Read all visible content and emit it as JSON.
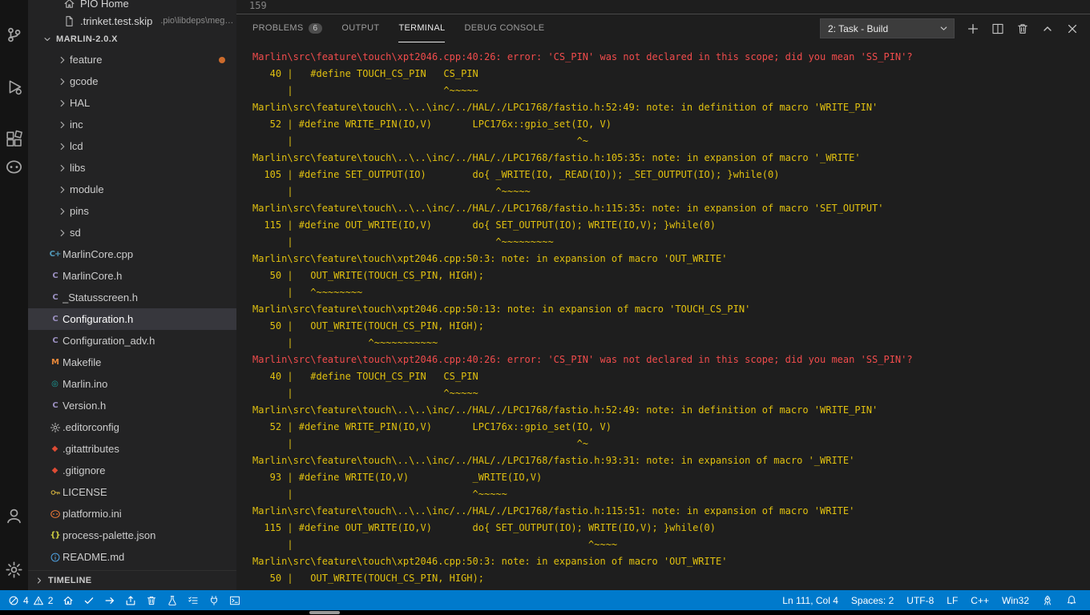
{
  "colors": {
    "accent": "#007acc",
    "terminal_error_red": "#f14c4c",
    "terminal_note_yellow": "#e0c010",
    "selected_row": "#37373d"
  },
  "window": {
    "editor_visible_line": "159"
  },
  "activity_bar": {
    "top": [
      {
        "icon": "source-control",
        "name": "activitybar-source-control"
      },
      {
        "icon": "run-debug",
        "name": "activitybar-run-and-debug"
      },
      {
        "icon": "extensions",
        "name": "activitybar-extensions"
      },
      {
        "icon": "platformio",
        "name": "activitybar-platformio"
      }
    ],
    "bottom": [
      {
        "icon": "account",
        "name": "activitybar-account"
      },
      {
        "icon": "settings",
        "name": "activitybar-manage"
      }
    ]
  },
  "sidebar": {
    "open_editors": [
      {
        "icon": "home",
        "label": "PIO Home",
        "name": "open-editor-pio-home"
      },
      {
        "icon": "file",
        "label": ".trinket.test.skip",
        "description": ".pio\\libdeps\\mega...",
        "name": "open-editor-trinket-test-skip"
      }
    ],
    "section_label": "MARLIN-2.0.X",
    "marlin_chevron": "chevron-down",
    "timeline_label": "TIMELINE",
    "timeline_chevron": "chevron-right",
    "tree": [
      {
        "type": "folder",
        "label": "feature",
        "modified": true
      },
      {
        "type": "folder",
        "label": "gcode"
      },
      {
        "type": "folder",
        "label": "HAL"
      },
      {
        "type": "folder",
        "label": "inc"
      },
      {
        "type": "folder",
        "label": "lcd"
      },
      {
        "type": "folder",
        "label": "libs"
      },
      {
        "type": "folder",
        "label": "module"
      },
      {
        "type": "folder",
        "label": "pins"
      },
      {
        "type": "folder",
        "label": "sd"
      },
      {
        "type": "file",
        "label": "MarlinCore.cpp",
        "icon": "cpp"
      },
      {
        "type": "file",
        "label": "MarlinCore.h",
        "icon": "h"
      },
      {
        "type": "file",
        "label": "_Statusscreen.h",
        "icon": "h"
      },
      {
        "type": "file",
        "label": "Configuration.h",
        "icon": "h",
        "selected": true
      },
      {
        "type": "file",
        "label": "Configuration_adv.h",
        "icon": "h"
      },
      {
        "type": "file",
        "label": "Makefile",
        "icon": "makefile"
      },
      {
        "type": "file",
        "label": "Marlin.ino",
        "icon": "ino"
      },
      {
        "type": "file",
        "label": "Version.h",
        "icon": "h"
      },
      {
        "type": "file",
        "label": ".editorconfig",
        "icon": "editorconfig"
      },
      {
        "type": "file",
        "label": ".gitattributes",
        "icon": "git"
      },
      {
        "type": "file",
        "label": ".gitignore",
        "icon": "git"
      },
      {
        "type": "file",
        "label": "LICENSE",
        "icon": "license"
      },
      {
        "type": "file",
        "label": "platformio.ini",
        "icon": "platformio-file"
      },
      {
        "type": "file",
        "label": "process-palette.json",
        "icon": "json"
      },
      {
        "type": "file",
        "label": "README.md",
        "icon": "readme"
      }
    ]
  },
  "panel": {
    "tabs": [
      {
        "label": "PROBLEMS",
        "badge": "6",
        "name": "tab-problems"
      },
      {
        "label": "OUTPUT",
        "name": "tab-output"
      },
      {
        "label": "TERMINAL",
        "active": true,
        "name": "tab-terminal"
      },
      {
        "label": "DEBUG CONSOLE",
        "name": "tab-debug-console"
      }
    ],
    "task_select": "2: Task - Build",
    "select_chevron": "chevron-down",
    "actions": [
      {
        "icon": "plus",
        "name": "new-terminal-button"
      },
      {
        "icon": "split",
        "name": "split-terminal-button"
      },
      {
        "icon": "trash",
        "name": "kill-terminal-button"
      },
      {
        "icon": "chevron-up",
        "name": "maximize-panel-button"
      },
      {
        "icon": "close",
        "name": "close-panel-button"
      }
    ]
  },
  "terminal": {
    "lines": [
      {
        "c": "r",
        "t": "Marlin\\src\\feature\\touch\\xpt2046.cpp:40:26: error: 'CS_PIN' was not declared in this scope; did you mean 'SS_PIN'?"
      },
      {
        "c": "y",
        "t": "   40 |   #define TOUCH_CS_PIN   CS_PIN"
      },
      {
        "c": "y",
        "t": "      |                          ^~~~~~"
      },
      {
        "c": "y",
        "t": "Marlin\\src\\feature\\touch\\..\\..\\inc/../HAL/./LPC1768/fastio.h:52:49: note: in definition of macro 'WRITE_PIN'"
      },
      {
        "c": "y",
        "t": "   52 | #define WRITE_PIN(IO,V)       LPC176x::gpio_set(IO, V)"
      },
      {
        "c": "y",
        "t": "      |                                                 ^~"
      },
      {
        "c": "y",
        "t": "Marlin\\src\\feature\\touch\\..\\..\\inc/../HAL/./LPC1768/fastio.h:105:35: note: in expansion of macro '_WRITE'"
      },
      {
        "c": "y",
        "t": "  105 | #define SET_OUTPUT(IO)        do{ _WRITE(IO, _READ(IO)); _SET_OUTPUT(IO); }while(0)"
      },
      {
        "c": "y",
        "t": "      |                                   ^~~~~~"
      },
      {
        "c": "y",
        "t": "Marlin\\src\\feature\\touch\\..\\..\\inc/../HAL/./LPC1768/fastio.h:115:35: note: in expansion of macro 'SET_OUTPUT'"
      },
      {
        "c": "y",
        "t": "  115 | #define OUT_WRITE(IO,V)       do{ SET_OUTPUT(IO); WRITE(IO,V); }while(0)"
      },
      {
        "c": "y",
        "t": "      |                                   ^~~~~~~~~~"
      },
      {
        "c": "y",
        "t": "Marlin\\src\\feature\\touch\\xpt2046.cpp:50:3: note: in expansion of macro 'OUT_WRITE'"
      },
      {
        "c": "y",
        "t": "   50 |   OUT_WRITE(TOUCH_CS_PIN, HIGH);"
      },
      {
        "c": "y",
        "t": "      |   ^~~~~~~~~"
      },
      {
        "c": "y",
        "t": "Marlin\\src\\feature\\touch\\xpt2046.cpp:50:13: note: in expansion of macro 'TOUCH_CS_PIN'"
      },
      {
        "c": "y",
        "t": "   50 |   OUT_WRITE(TOUCH_CS_PIN, HIGH);"
      },
      {
        "c": "y",
        "t": "      |             ^~~~~~~~~~~~"
      },
      {
        "c": "r",
        "t": "Marlin\\src\\feature\\touch\\xpt2046.cpp:40:26: error: 'CS_PIN' was not declared in this scope; did you mean 'SS_PIN'?"
      },
      {
        "c": "y",
        "t": "   40 |   #define TOUCH_CS_PIN   CS_PIN"
      },
      {
        "c": "y",
        "t": "      |                          ^~~~~~"
      },
      {
        "c": "y",
        "t": "Marlin\\src\\feature\\touch\\..\\..\\inc/../HAL/./LPC1768/fastio.h:52:49: note: in definition of macro 'WRITE_PIN'"
      },
      {
        "c": "y",
        "t": "   52 | #define WRITE_PIN(IO,V)       LPC176x::gpio_set(IO, V)"
      },
      {
        "c": "y",
        "t": "      |                                                 ^~"
      },
      {
        "c": "y",
        "t": "Marlin\\src\\feature\\touch\\..\\..\\inc/../HAL/./LPC1768/fastio.h:93:31: note: in expansion of macro '_WRITE'"
      },
      {
        "c": "y",
        "t": "   93 | #define WRITE(IO,V)           _WRITE(IO,V)"
      },
      {
        "c": "y",
        "t": "      |                               ^~~~~~"
      },
      {
        "c": "y",
        "t": "Marlin\\src\\feature\\touch\\..\\..\\inc/../HAL/./LPC1768/fastio.h:115:51: note: in expansion of macro 'WRITE'"
      },
      {
        "c": "y",
        "t": "  115 | #define OUT_WRITE(IO,V)       do{ SET_OUTPUT(IO); WRITE(IO,V); }while(0)"
      },
      {
        "c": "y",
        "t": "      |                                                   ^~~~~"
      },
      {
        "c": "y",
        "t": "Marlin\\src\\feature\\touch\\xpt2046.cpp:50:3: note: in expansion of macro 'OUT_WRITE'"
      },
      {
        "c": "y",
        "t": "   50 |   OUT_WRITE(TOUCH_CS_PIN, HIGH);"
      }
    ]
  },
  "status_bar": {
    "error_icon": "circle-slash",
    "error_count": "4",
    "warning_icon": "warning",
    "warning_count": "2",
    "pio_buttons": [
      {
        "icon": "home",
        "name": "pio-home-button"
      },
      {
        "icon": "check",
        "name": "pio-build-button"
      },
      {
        "icon": "arrow-right",
        "name": "pio-upload-button"
      },
      {
        "icon": "upload",
        "name": "pio-upload-fs-button"
      },
      {
        "icon": "trash",
        "name": "pio-clean-button"
      },
      {
        "icon": "beaker",
        "name": "pio-test-button"
      },
      {
        "icon": "checklist",
        "name": "pio-project-tasks-button"
      },
      {
        "icon": "plug",
        "name": "pio-serial-monitor-button"
      },
      {
        "icon": "terminal",
        "name": "pio-new-terminal-button"
      }
    ],
    "right_items": [
      {
        "label": "Ln 111, Col 4",
        "name": "cursor-position"
      },
      {
        "label": "Spaces: 2",
        "name": "indentation-indicator"
      },
      {
        "label": "UTF-8",
        "name": "encoding-indicator"
      },
      {
        "label": "LF",
        "name": "eol-indicator"
      },
      {
        "label": "C++",
        "name": "language-mode-indicator"
      },
      {
        "label": "Win32",
        "name": "platform-indicator"
      }
    ],
    "right_icons": [
      {
        "icon": "rocket",
        "name": "platformio-statusbar-button"
      },
      {
        "icon": "bell",
        "name": "notifications-button"
      }
    ]
  }
}
